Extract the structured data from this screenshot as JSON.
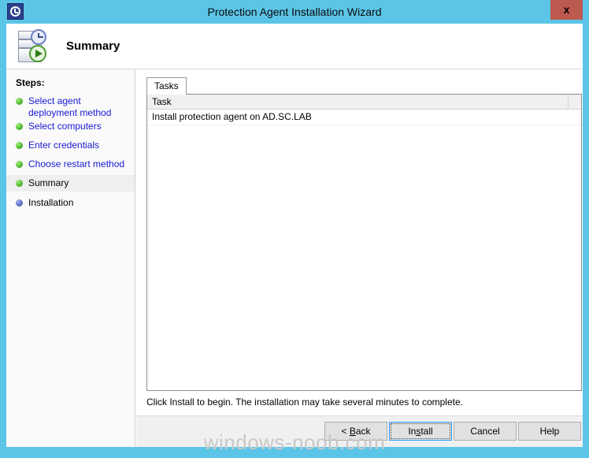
{
  "window": {
    "title": "Protection Agent Installation Wizard",
    "icon": "clock-refresh-icon",
    "close_label": "x",
    "accent_color": "#5bc5e8",
    "close_color": "#bc5a50"
  },
  "header": {
    "title": "Summary",
    "icon": "server-clock-play-icon"
  },
  "sidebar": {
    "label": "Steps:",
    "items": [
      {
        "label": "Select agent deployment method",
        "state": "done"
      },
      {
        "label": "Select computers",
        "state": "done"
      },
      {
        "label": "Enter credentials",
        "state": "done"
      },
      {
        "label": "Choose restart method",
        "state": "done"
      },
      {
        "label": "Summary",
        "state": "current"
      },
      {
        "label": "Installation",
        "state": "pending"
      }
    ]
  },
  "main": {
    "tabs": [
      {
        "label": "Tasks",
        "active": true
      }
    ],
    "grid": {
      "columns": [
        "Task"
      ],
      "rows": [
        [
          "Install protection agent on AD.SC.LAB"
        ]
      ]
    },
    "hint": "Click Install to begin. The installation may take several minutes to complete."
  },
  "buttons": {
    "back": {
      "prefix": "< ",
      "accel": "B",
      "rest": "ack"
    },
    "install": {
      "prefix": "In",
      "accel": "s",
      "rest": "tall"
    },
    "cancel": "Cancel",
    "help": "Help"
  },
  "watermark": "windows-noob.com"
}
